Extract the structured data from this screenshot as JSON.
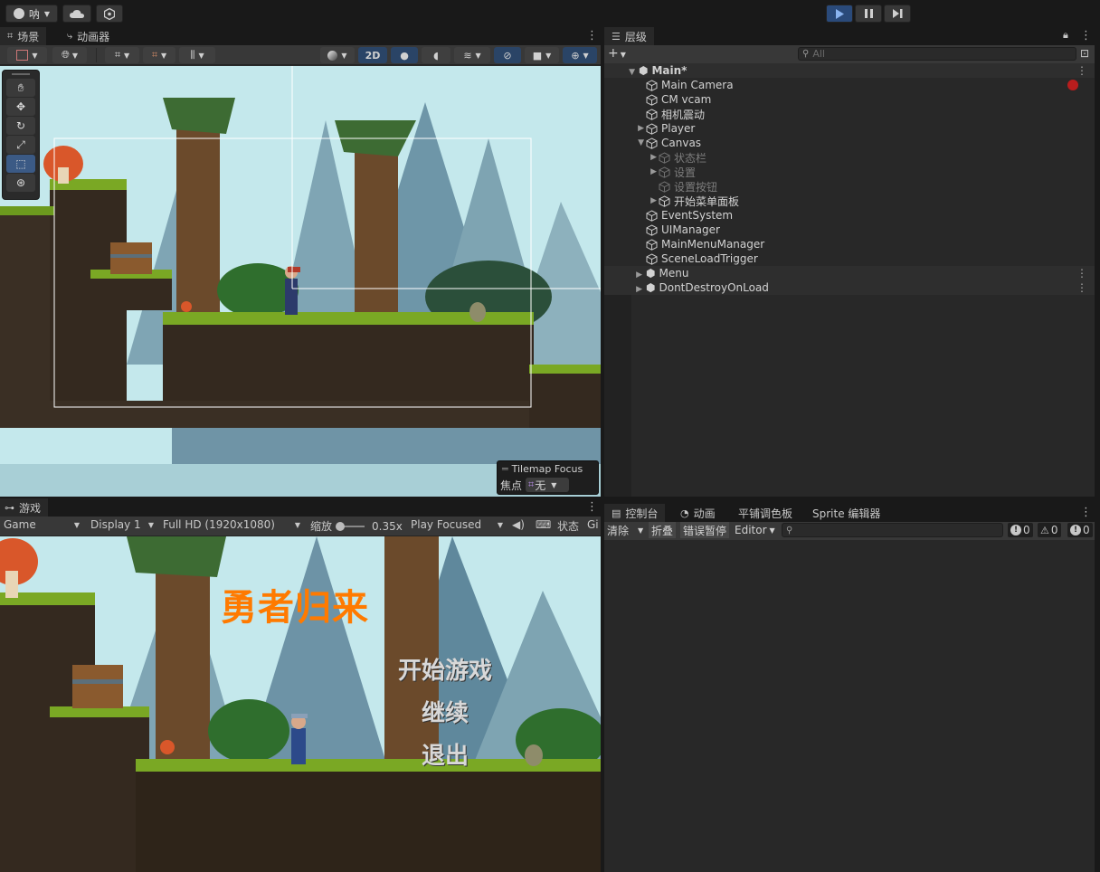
{
  "toolbar": {
    "account_label": "呐",
    "play_state": "playing"
  },
  "scene_panel": {
    "tabs": [
      {
        "label": "场景",
        "icon": "grid-icon"
      },
      {
        "label": "动画器",
        "icon": "animator-icon"
      }
    ],
    "toolbar_2d_label": "2D",
    "tilemap_focus": {
      "title": "Tilemap Focus",
      "label": "焦点",
      "value": "无"
    }
  },
  "game_panel": {
    "tab_label": "游戏",
    "display_mode": "Game",
    "display": "Display 1",
    "resolution": "Full HD (1920x1080)",
    "scale_label": "缩放",
    "scale_value": "0.35x",
    "play_mode": "Play Focused",
    "stats_label": "状态",
    "gizmos_label": "Gi"
  },
  "game_menu": {
    "title": "勇者归来",
    "items": [
      "开始游戏",
      "继续",
      "退出"
    ],
    "title_color": "#ff7a00"
  },
  "hierarchy": {
    "tab_label": "层级",
    "search_placeholder": "All",
    "scene_name": "Main*",
    "rows": [
      {
        "label": "Main Camera",
        "depth": 2,
        "expand": ""
      },
      {
        "label": "CM vcam",
        "depth": 2,
        "expand": ""
      },
      {
        "label": "相机震动",
        "depth": 2,
        "expand": ""
      },
      {
        "label": "Player",
        "depth": 2,
        "expand": "▶"
      },
      {
        "label": "Canvas",
        "depth": 2,
        "expand": "▼"
      },
      {
        "label": "状态栏",
        "depth": 3,
        "expand": "▶",
        "dim": true
      },
      {
        "label": "设置",
        "depth": 3,
        "expand": "▶",
        "dim": true
      },
      {
        "label": "设置按钮",
        "depth": 3,
        "expand": "",
        "dim": true
      },
      {
        "label": "开始菜单面板",
        "depth": 3,
        "expand": "▶"
      },
      {
        "label": "EventSystem",
        "depth": 2,
        "expand": ""
      },
      {
        "label": "UIManager",
        "depth": 2,
        "expand": ""
      },
      {
        "label": "MainMenuManager",
        "depth": 2,
        "expand": ""
      },
      {
        "label": "SceneLoadTrigger",
        "depth": 2,
        "expand": ""
      }
    ],
    "other_scenes": [
      "Menu",
      "DontDestroyOnLoad"
    ]
  },
  "console_panel": {
    "tabs": [
      {
        "label": "控制台",
        "icon": "console-icon"
      },
      {
        "label": "动画",
        "icon": "animation-icon"
      },
      {
        "label": "平铺调色板",
        "icon": ""
      },
      {
        "label": "Sprite 编辑器",
        "icon": ""
      }
    ],
    "clear_label": "清除",
    "collapse_label": "折叠",
    "error_pause_label": "错误暂停",
    "editor_label": "Editor",
    "counts": {
      "info": "0",
      "warning": "0",
      "error": "0"
    }
  }
}
